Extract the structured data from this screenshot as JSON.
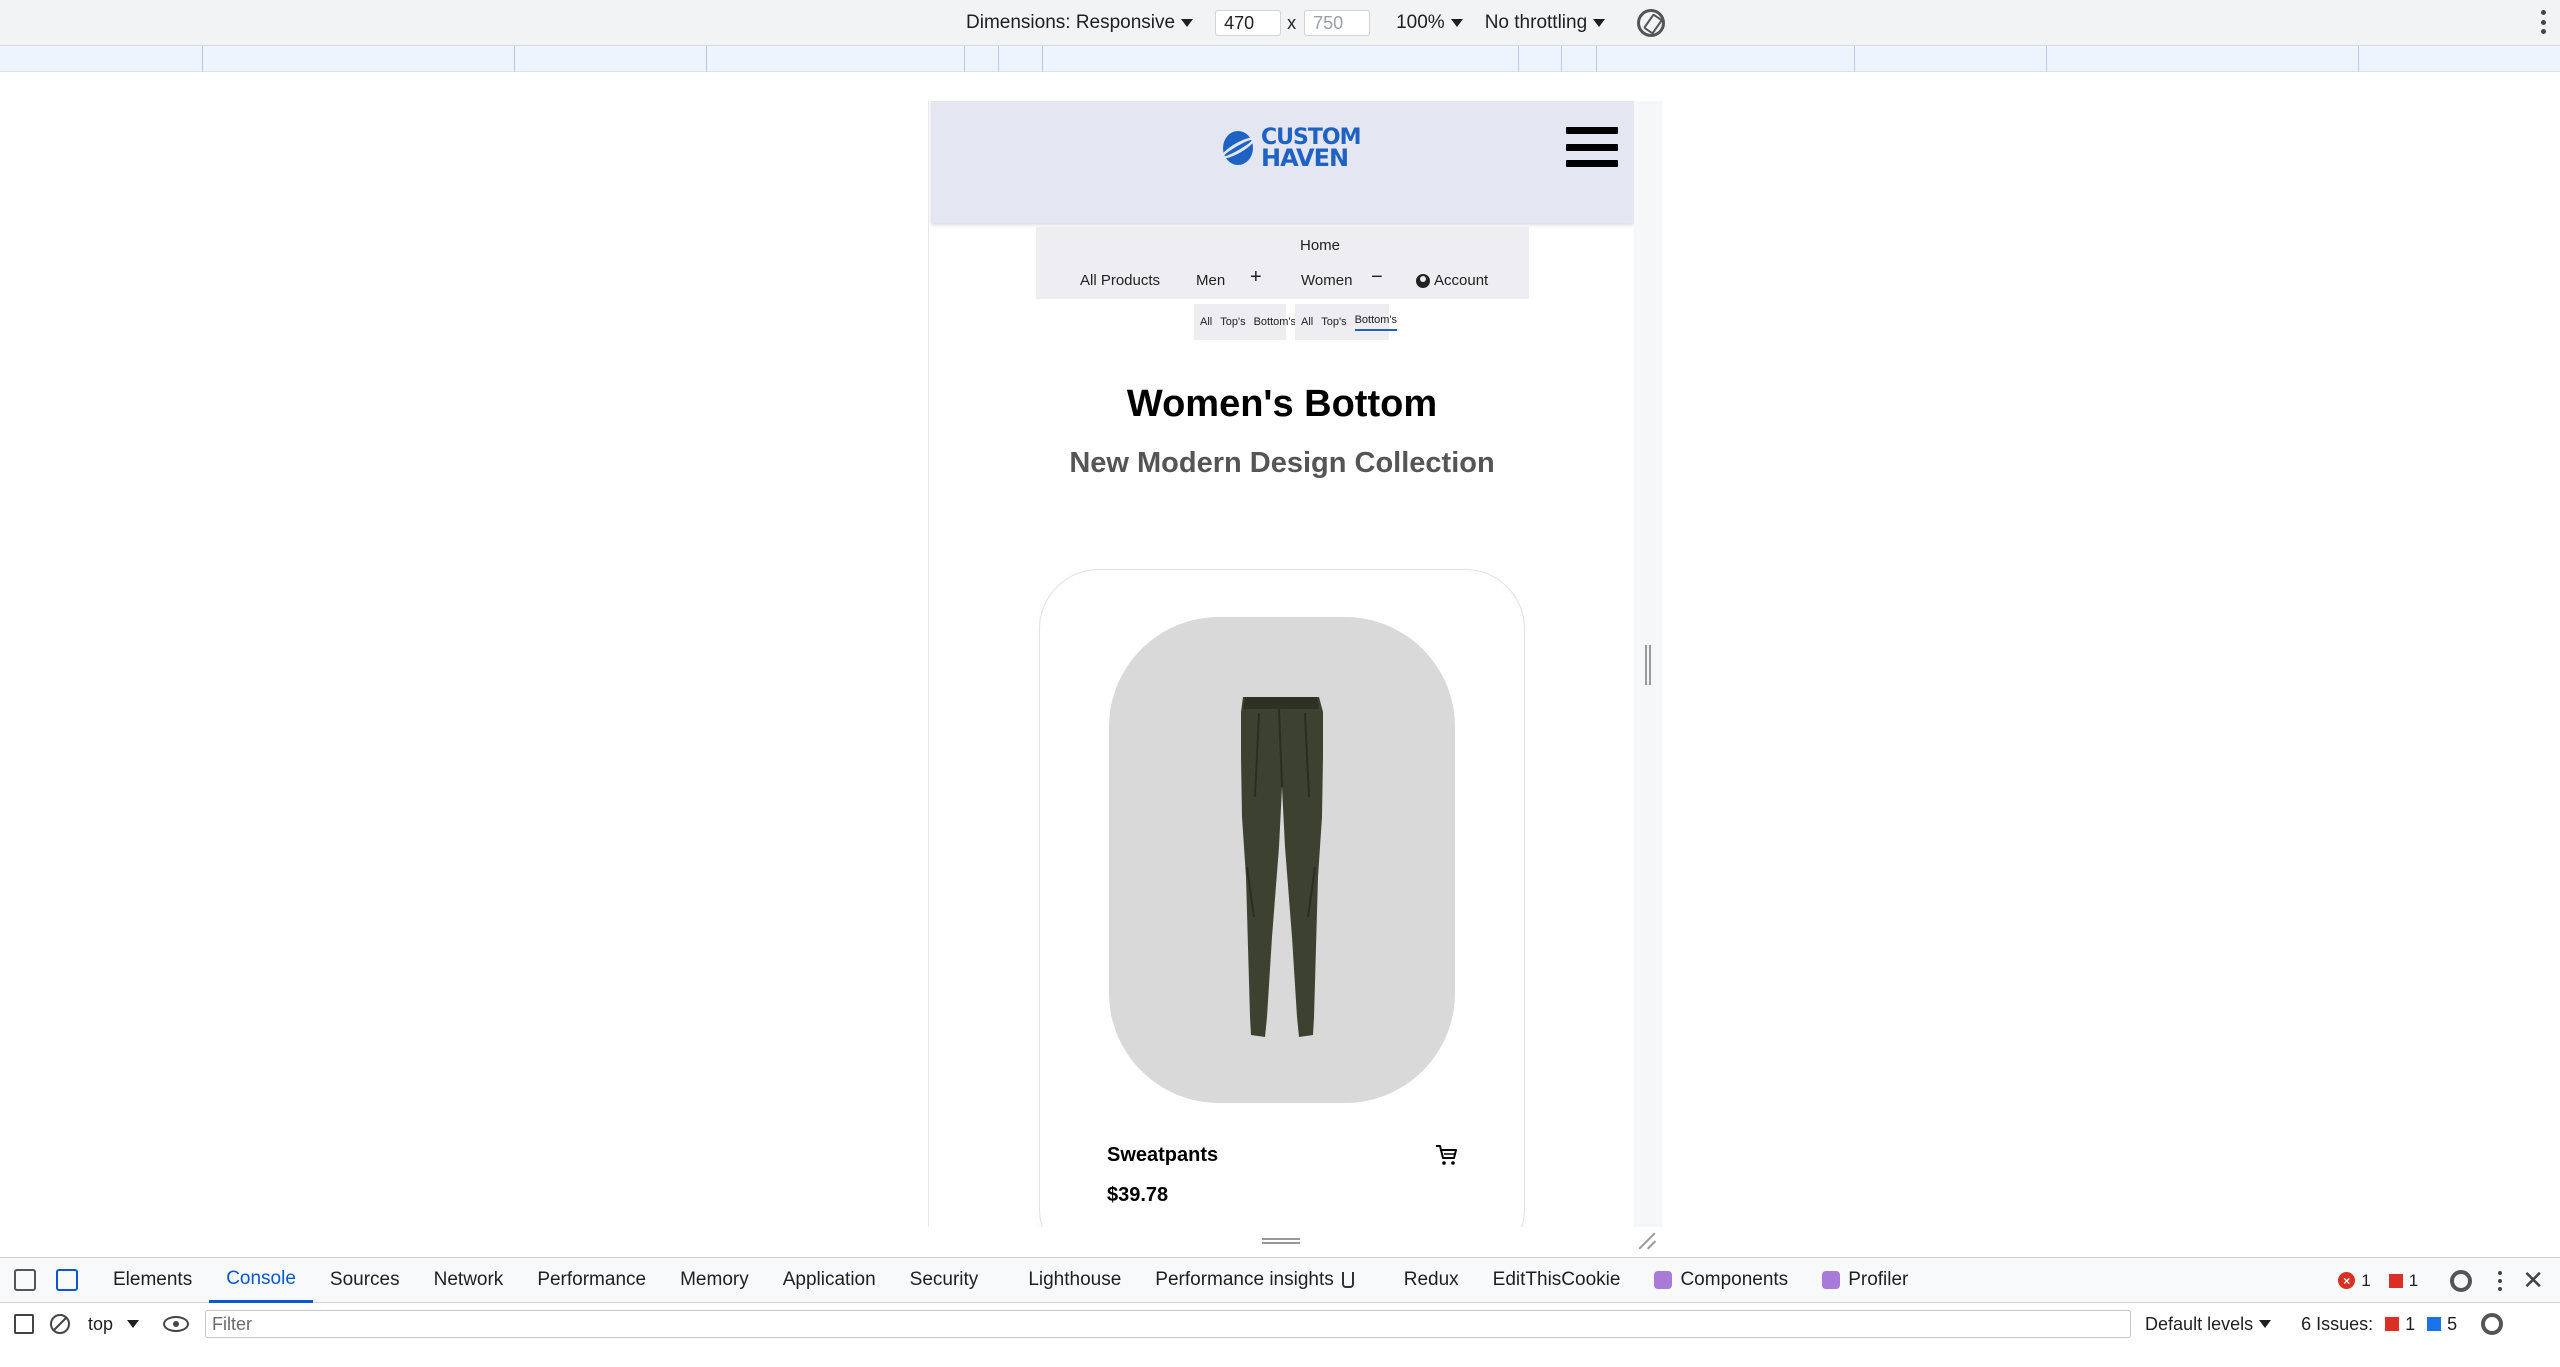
{
  "device_toolbar": {
    "dimensions_label": "Dimensions: Responsive",
    "width_value": "470",
    "times": "x",
    "height_placeholder": "750",
    "zoom": "100%",
    "throttling": "No throttling"
  },
  "site": {
    "logo_line1": "CUSTOM",
    "logo_line2": "HAVEN",
    "nav": {
      "home": "Home",
      "all_products": "All Products",
      "men": "Men",
      "men_toggle": "+",
      "women": "Women",
      "women_toggle": "−",
      "account": "Account"
    },
    "men_sub": [
      "All",
      "Top's",
      "Bottom's"
    ],
    "women_sub": [
      "All",
      "Top's",
      "Bottom's"
    ],
    "page_title": "Women's Bottom",
    "page_subtitle": "New Modern Design Collection",
    "product": {
      "name": "Sweatpants",
      "price": "$39.78"
    }
  },
  "devtools": {
    "tabs": [
      "Elements",
      "Console",
      "Sources",
      "Network",
      "Performance",
      "Memory",
      "Application",
      "Security",
      "Lighthouse",
      "Performance insights",
      "Redux",
      "EditThisCookie",
      "Components",
      "Profiler"
    ],
    "active_tab": "Console",
    "errors_count": "1",
    "warnings_count": "1",
    "context": "top",
    "filter_placeholder": "Filter",
    "levels": "Default levels",
    "issues_label": "6 Issues:",
    "issues_red": "1",
    "issues_blue": "5"
  }
}
